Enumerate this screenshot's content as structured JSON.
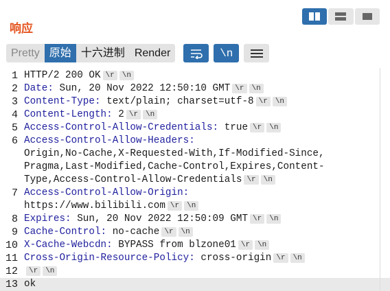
{
  "title": "响应",
  "tabs": [
    "Pretty",
    "原始",
    "十六进制",
    "Render"
  ],
  "active_tab": "原始",
  "newline_button_label": "\\n",
  "cr_token": "\\r",
  "lf_token": "\\n",
  "colors": {
    "accent": "#2f6fad",
    "title": "#e5541e",
    "header_key": "#1f1f9e"
  },
  "icons": [
    "layout-split-icon",
    "layout-rows-icon",
    "layout-single-icon",
    "wrap-icon",
    "menu-icon"
  ],
  "lines": [
    {
      "num": "1",
      "text": "HTTP/2 200 OK"
    },
    {
      "num": "2",
      "key": "Date:",
      "value": " Sun, 20 Nov 2022 12:50:10 GMT"
    },
    {
      "num": "3",
      "key": "Content-Type:",
      "value": " text/plain; charset=utf-8"
    },
    {
      "num": "4",
      "key": "Content-Length:",
      "value": " 2"
    },
    {
      "num": "5",
      "key": "Access-Control-Allow-Credentials:",
      "value": " true"
    },
    {
      "num": "6",
      "key": "Access-Control-Allow-Headers:",
      "cont": [
        "Origin,No-Cache,X-Requested-With,If-Modified-Since,",
        "Pragma,Last-Modified,Cache-Control,Expires,Content-",
        "Type,Access-Control-Allow-Credentials"
      ]
    },
    {
      "num": "7",
      "key": "Access-Control-Allow-Origin:",
      "cont": [
        "https://www.bilibili.com"
      ]
    },
    {
      "num": "8",
      "key": "Expires:",
      "value": " Sun, 20 Nov 2022 12:50:09 GMT"
    },
    {
      "num": "9",
      "key": "Cache-Control:",
      "value": " no-cache"
    },
    {
      "num": "10",
      "key": "X-Cache-Webcdn:",
      "value": " BYPASS from blzone01"
    },
    {
      "num": "11",
      "key": "Cross-Origin-Resource-Policy:",
      "value": " cross-origin"
    },
    {
      "num": "12",
      "text": ""
    },
    {
      "num": "13",
      "text": "ok",
      "no_esc": true
    }
  ]
}
